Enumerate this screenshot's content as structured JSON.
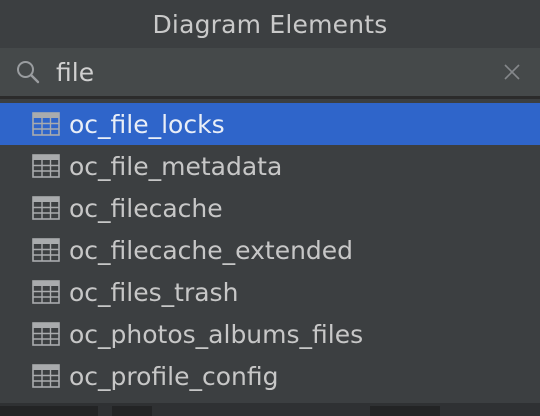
{
  "popup": {
    "title": "Diagram Elements"
  },
  "search": {
    "value": "file",
    "icon": "search-icon",
    "clear_icon": "close-icon"
  },
  "list": {
    "selected_index": 0,
    "item_icon": "table-icon",
    "items": [
      {
        "label": "oc_file_locks"
      },
      {
        "label": "oc_file_metadata"
      },
      {
        "label": "oc_filecache"
      },
      {
        "label": "oc_filecache_extended"
      },
      {
        "label": "oc_files_trash"
      },
      {
        "label": "oc_photos_albums_files"
      },
      {
        "label": "oc_profile_config"
      }
    ]
  },
  "colors": {
    "background": "#3c3f41",
    "search_background": "#45494a",
    "selection": "#2f65ca",
    "text": "#c7c7c7"
  }
}
